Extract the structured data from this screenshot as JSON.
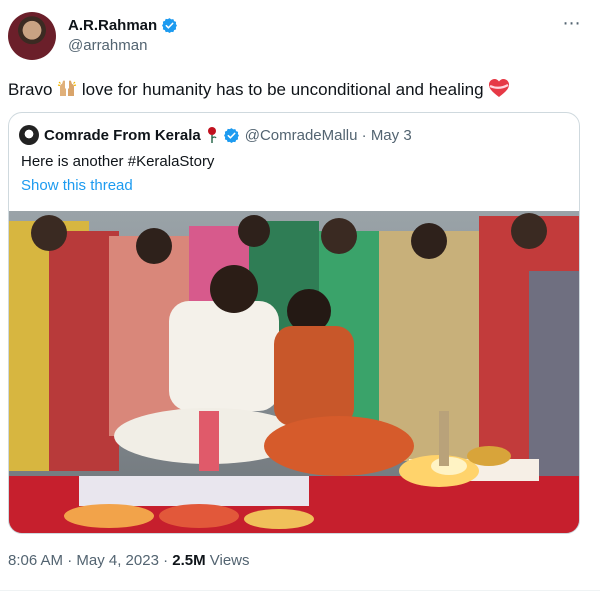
{
  "author": {
    "display_name": "A.R.Rahman",
    "handle": "@arrahman",
    "verified": true
  },
  "more_icon": "⋯",
  "tweet": {
    "text_before": "Bravo",
    "text_after": "love for humanity has to be unconditional and healing",
    "emojis": [
      "raised-hands-icon",
      "heart-with-ribbon-icon"
    ]
  },
  "quoted": {
    "display_name": "Comrade From Kerala",
    "rose_icon": "rose-icon",
    "verified": true,
    "handle_date": "@ComradeMallu · May 3",
    "text": "Here is another #KeralaStory",
    "show_thread": "Show this thread"
  },
  "footer": {
    "time_date": "8:06 AM · May 4, 2023 · ",
    "views_count": "2.5M",
    "views_label": " Views"
  },
  "colors": {
    "link": "#1d9bf0",
    "secondary_text": "#536471",
    "primary_text": "#0f1419",
    "border": "#cfd9de"
  }
}
